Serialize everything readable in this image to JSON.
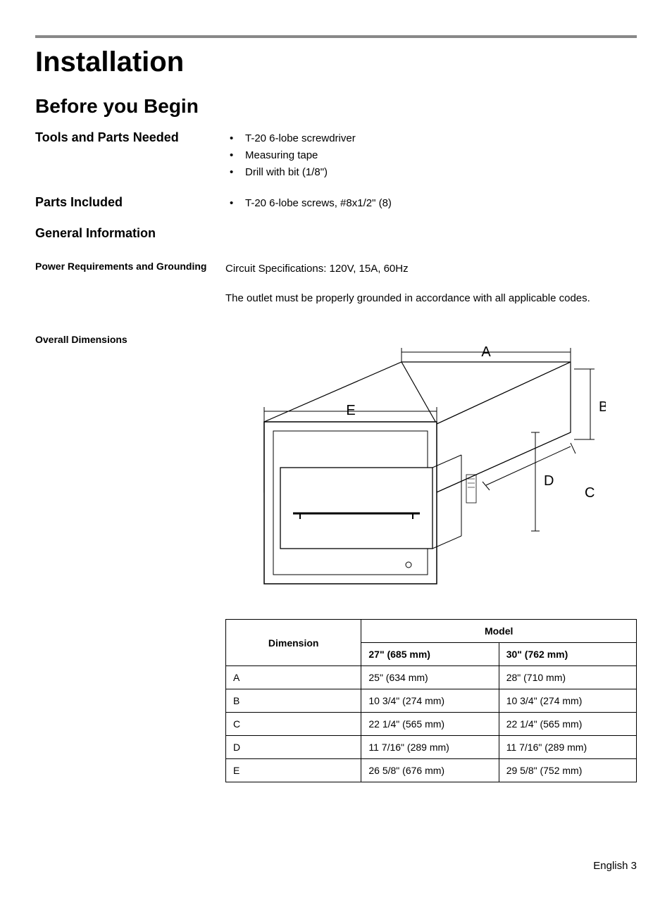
{
  "title": "Installation",
  "subtitle": "Before you Begin",
  "tools": {
    "heading": "Tools and Parts Needed",
    "items": [
      "T-20 6-lobe screwdriver",
      "Measuring tape",
      "Drill with bit (1/8\")"
    ]
  },
  "parts": {
    "heading": "Parts Included",
    "items": [
      "T-20 6-lobe screws, #8x1/2\" (8)"
    ]
  },
  "general": {
    "heading": "General Information",
    "power": {
      "heading": "Power Requirements and Grounding",
      "spec": "Circuit Specifications: 120V, 15A, 60Hz",
      "note": "The outlet must be properly grounded in accordance with all applicable codes."
    },
    "overall": {
      "heading": "Overall Dimensions"
    }
  },
  "diagram_labels": {
    "A": "A",
    "B": "B",
    "C": "C",
    "D": "D",
    "E": "E"
  },
  "table": {
    "headers": {
      "dimension": "Dimension",
      "model": "Model"
    },
    "models": {
      "m27": "27\" (685 mm)",
      "m30": "30\" (762 mm)"
    },
    "rows": [
      {
        "dim": "A",
        "m27": "25\" (634 mm)",
        "m30": "28\" (710 mm)"
      },
      {
        "dim": "B",
        "m27": "10 3/4\" (274 mm)",
        "m30": "10 3/4\" (274 mm)"
      },
      {
        "dim": "C",
        "m27": "22 1/4\" (565 mm)",
        "m30": "22 1/4\" (565 mm)"
      },
      {
        "dim": "D",
        "m27": "11 7/16\" (289 mm)",
        "m30": "11 7/16\" (289 mm)"
      },
      {
        "dim": "E",
        "m27": "26 5/8\" (676 mm)",
        "m30": "29 5/8\" (752 mm)"
      }
    ]
  },
  "footer": "English 3"
}
